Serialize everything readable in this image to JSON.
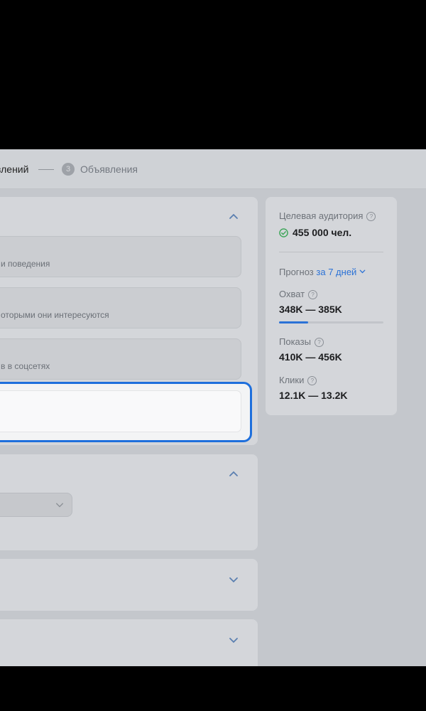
{
  "stepper": {
    "prev_label": "влений",
    "current_number": "3",
    "current_label": "Объявления"
  },
  "targeting": {
    "options": [
      {
        "desc": "и поведения"
      },
      {
        "desc": "оторыми они интересуются"
      },
      {
        "desc": "в в соцсетях"
      }
    ],
    "focused_input_value": ""
  },
  "sidebar": {
    "audience_label": "Целевая аудитория",
    "audience_value": "455 000 чел.",
    "forecast_label": "Прогноз",
    "forecast_period": "за 7 дней",
    "reach_label": "Охват",
    "reach_value": "348K — 385K",
    "reach_progress": 0.28,
    "impressions_label": "Показы",
    "impressions_value": "410K — 456K",
    "clicks_label": "Клики",
    "clicks_value": "12.1K — 13.2K",
    "help_icon": "question-circle-icon",
    "ok_icon": "check-circle-icon"
  },
  "colors": {
    "accent": "#2b72d6",
    "focus": "#1e6fdc",
    "success": "#3aa556"
  }
}
